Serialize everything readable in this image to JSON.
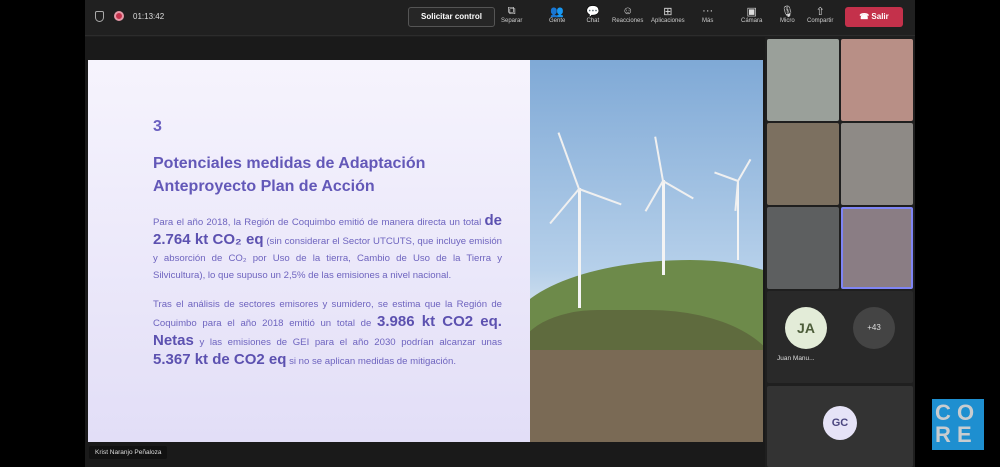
{
  "toolbar": {
    "timer": "01:13:42",
    "request_control": "Solicitar control",
    "buttons": [
      {
        "label": "Separar",
        "icon": "pop-out-icon"
      },
      {
        "label": "Gente",
        "icon": "people-icon"
      },
      {
        "label": "Chat",
        "icon": "chat-icon"
      },
      {
        "label": "Reacciones",
        "icon": "reactions-icon"
      },
      {
        "label": "Aplicaciones",
        "icon": "apps-icon"
      },
      {
        "label": "Más",
        "icon": "more-icon"
      },
      {
        "label": "Cámara",
        "icon": "camera-off-icon"
      },
      {
        "label": "Micro",
        "icon": "mic-off-icon"
      },
      {
        "label": "Compartir",
        "icon": "share-icon"
      }
    ],
    "leave": "Salir"
  },
  "slide": {
    "number": "3",
    "title_line1": "Potenciales medidas de Adaptación",
    "title_line2": "Anteproyecto Plan de Acción",
    "p1_a": "Para el año 2018, la Región de Coquimbo emitió de manera directa un total ",
    "p1_big": "de 2.764 kt CO₂ eq",
    "p1_b": " (sin considerar el Sector UTCUTS, que incluye emisión y absorción de CO₂ por Uso de la tierra, Cambio de Uso de la Tierra y Silvicultura), lo que supuso un 2,5% de las emisiones a nivel nacional.",
    "p2_a": "Tras el análisis de sectores emisores y sumidero, se estima que la Región de Coquimbo para el año 2018 emitió un total de ",
    "p2_big1": "3.986 kt CO2 eq. Netas",
    "p2_b": " y las emisiones de GEI para el año 2030 podrían alcanzar unas ",
    "p2_big2": "5.367 kt de CO2 eq",
    "p2_c": " si no se aplican medidas de mitigación."
  },
  "presenter_name": "Krist Naranjo Peñaloza",
  "participants": {
    "ja_initials": "JA",
    "ja_name": "Juan Manu...",
    "overflow": "+43",
    "gc_initials": "GC"
  },
  "logo_text": "CORE",
  "colors": {
    "accent": "#6a5fc0",
    "leave": "#c4314b"
  }
}
